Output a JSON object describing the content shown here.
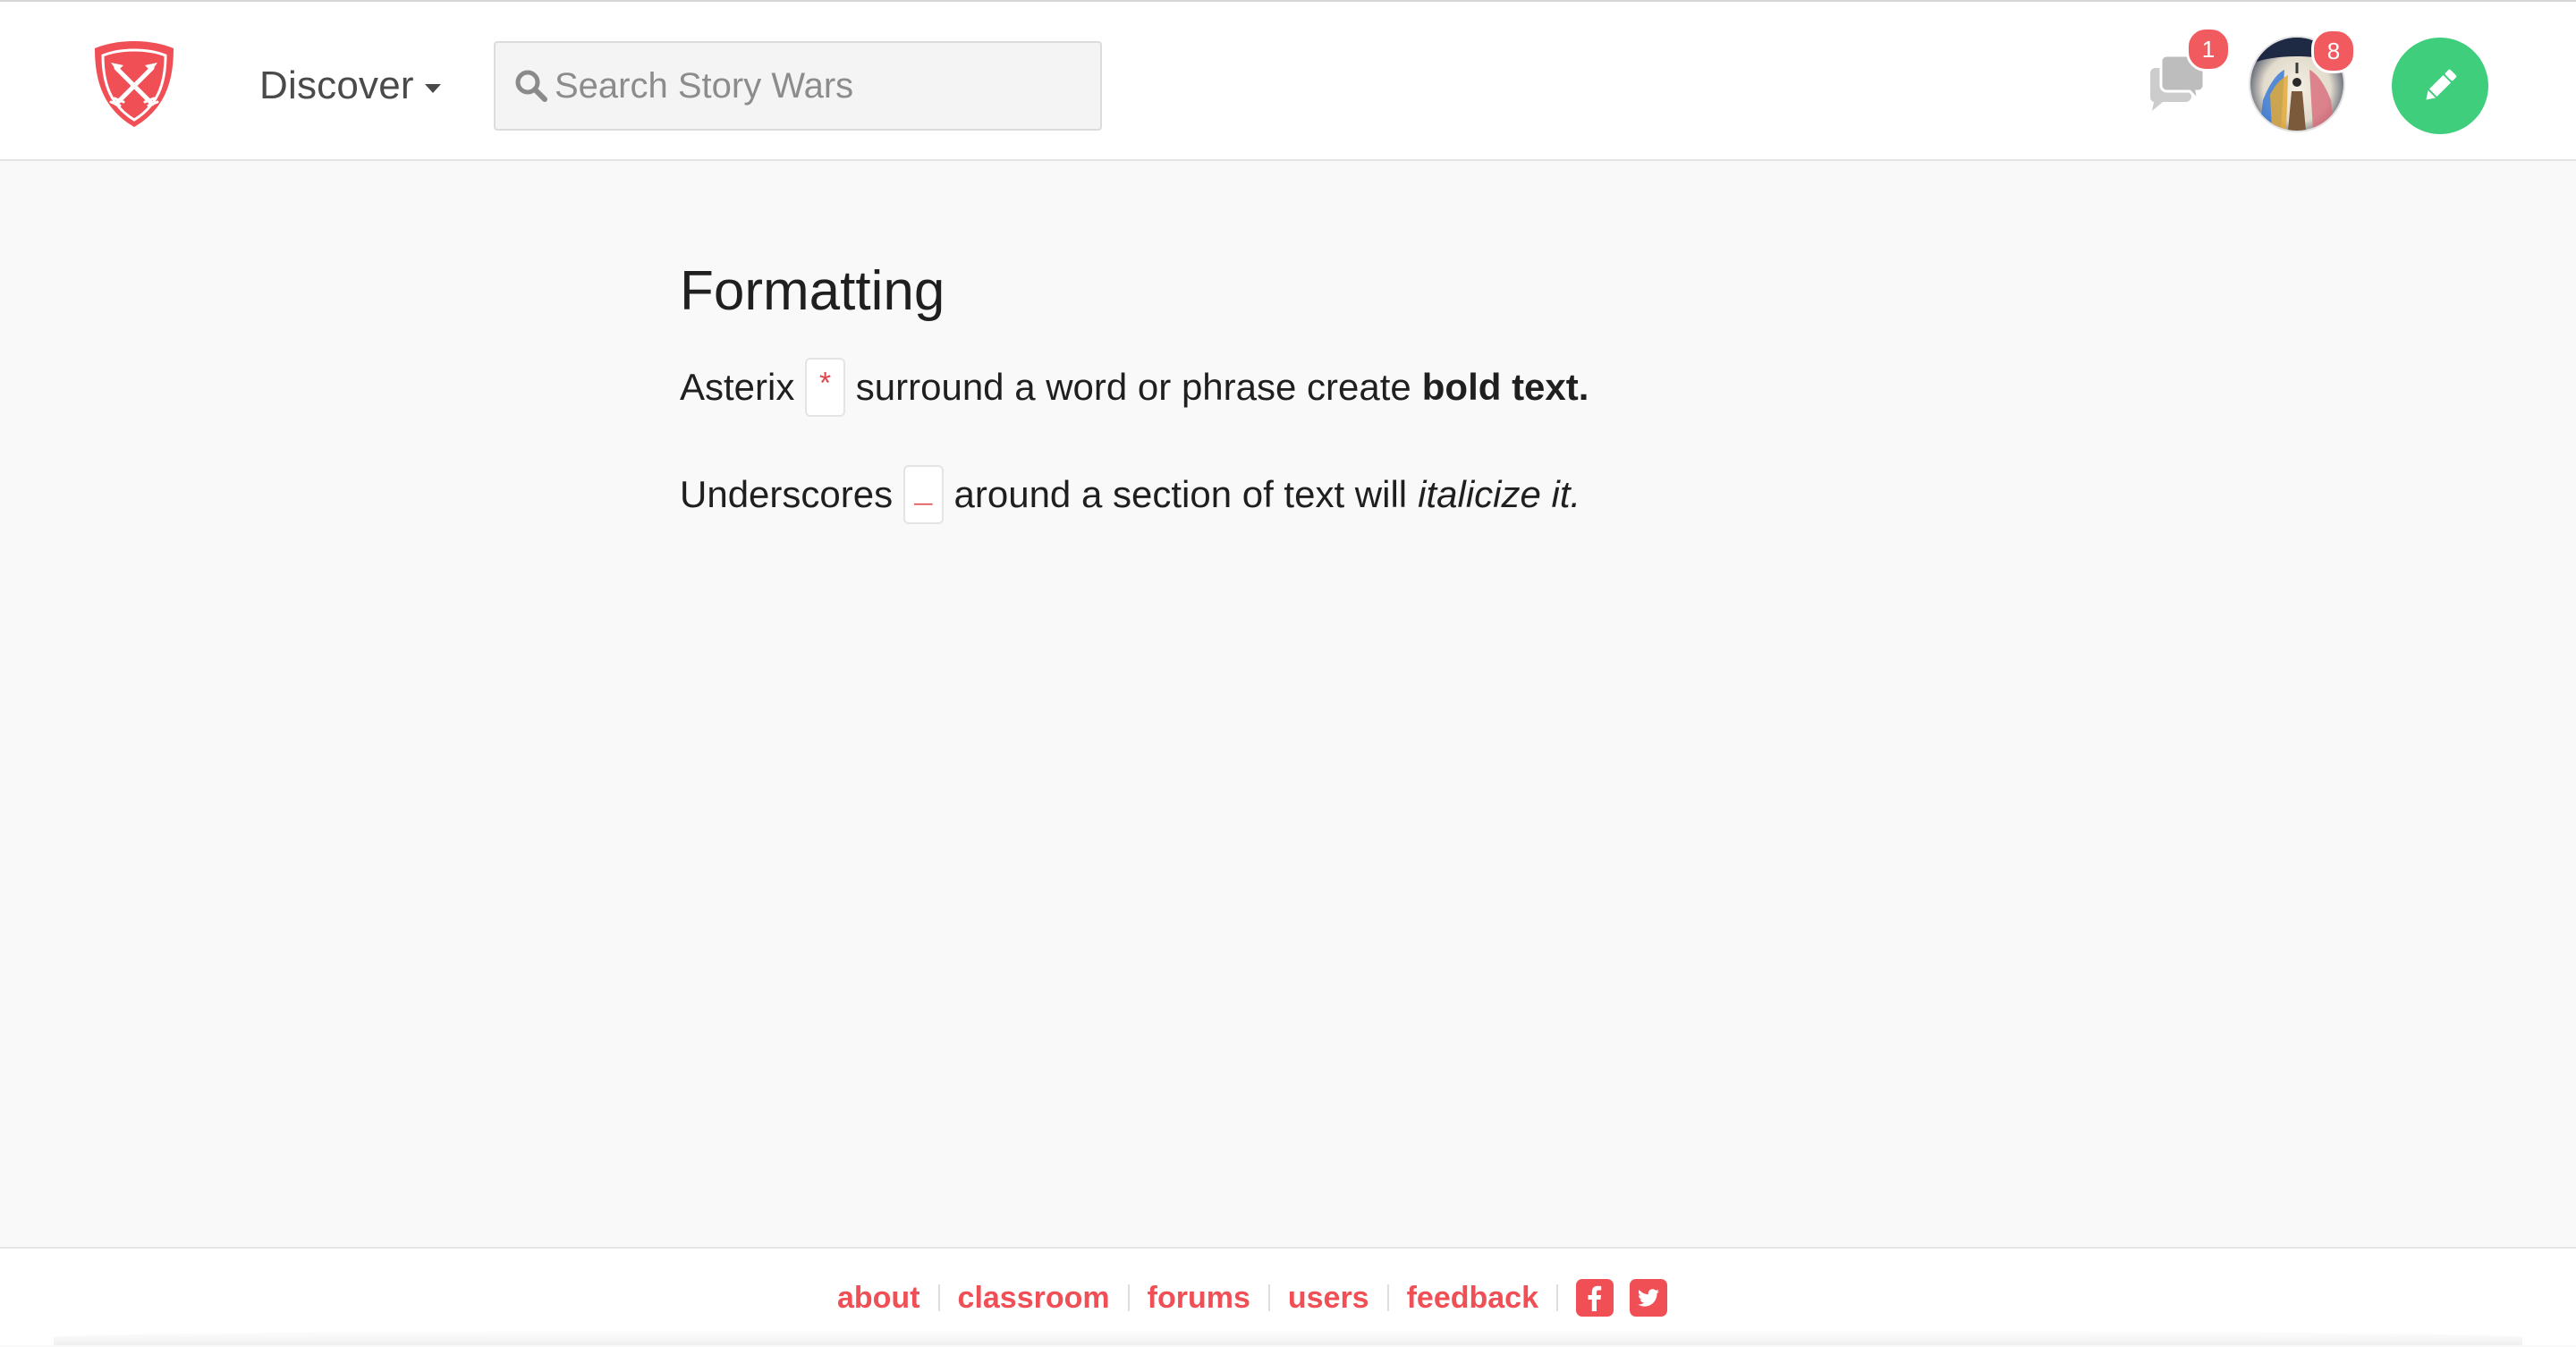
{
  "colors": {
    "brand_red": "#ef4f55",
    "badge_red": "#f15a5f",
    "compose_green": "#3fcf7c",
    "page_background": "#f9f9f9"
  },
  "header": {
    "logo_icon": "shield-crossed-arrows-icon",
    "discover_label": "Discover",
    "discover_icon": "caret-down-icon",
    "search": {
      "icon": "search-icon",
      "placeholder": "Search Story Wars",
      "value": ""
    },
    "messages": {
      "icon": "chat-bubbles-icon",
      "badge_count": "1"
    },
    "profile": {
      "icon": "avatar",
      "badge_count": "8"
    },
    "compose_icon": "pencil-icon"
  },
  "content": {
    "title": "Formatting",
    "rules": [
      {
        "prefix": "Asterix",
        "symbol": "*",
        "middle": "surround a word or phrase create",
        "example": "bold text.",
        "example_style": "bold"
      },
      {
        "prefix": "Underscores",
        "symbol": "_",
        "middle": "around a section of text will",
        "example": "italicize it.",
        "example_style": "italic"
      }
    ]
  },
  "footer": {
    "links": [
      "about",
      "classroom",
      "forums",
      "users",
      "feedback"
    ],
    "social": [
      "facebook-icon",
      "twitter-icon"
    ]
  }
}
